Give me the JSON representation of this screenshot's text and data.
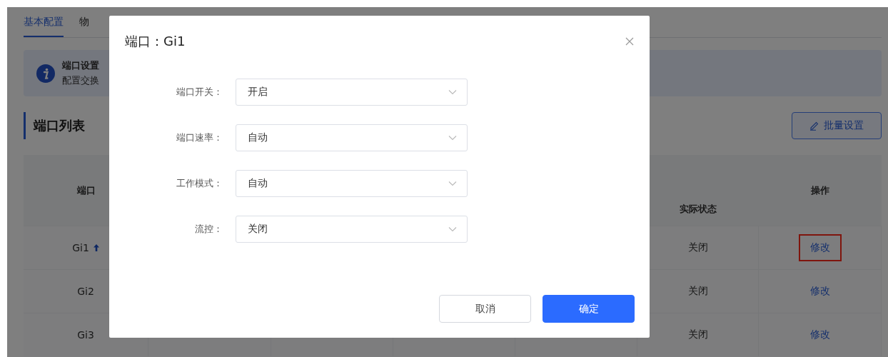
{
  "tabs": [
    {
      "label": "基本配置",
      "selected": true
    },
    {
      "label": "物",
      "selected": false
    }
  ],
  "notice": {
    "title": "端口设置",
    "text": "配置交换"
  },
  "section": {
    "title": "端口列表",
    "button": "批量设置"
  },
  "table": {
    "columns": {
      "port": "端口",
      "actual_state": "实际状态",
      "action": "操作"
    },
    "rows": [
      {
        "port": "Gi1",
        "uplink": true,
        "actual_state": "关闭",
        "action": "修改",
        "highlighted": true
      },
      {
        "port": "Gi2",
        "uplink": false,
        "actual_state": "关闭",
        "action": "修改",
        "highlighted": false
      },
      {
        "port": "Gi3",
        "uplink": false,
        "actual_state": "关闭",
        "action": "修改",
        "highlighted": false
      }
    ]
  },
  "dialog": {
    "title": "端口：Gi1",
    "fields": [
      {
        "label": "端口开关：",
        "value": "开启"
      },
      {
        "label": "端口速率：",
        "value": "自动"
      },
      {
        "label": "工作模式：",
        "value": "自动"
      },
      {
        "label": "流控：",
        "value": "关闭"
      }
    ],
    "buttons": [
      {
        "label": "取消",
        "kind": "secondary"
      },
      {
        "label": "确定",
        "kind": "primary"
      }
    ]
  }
}
